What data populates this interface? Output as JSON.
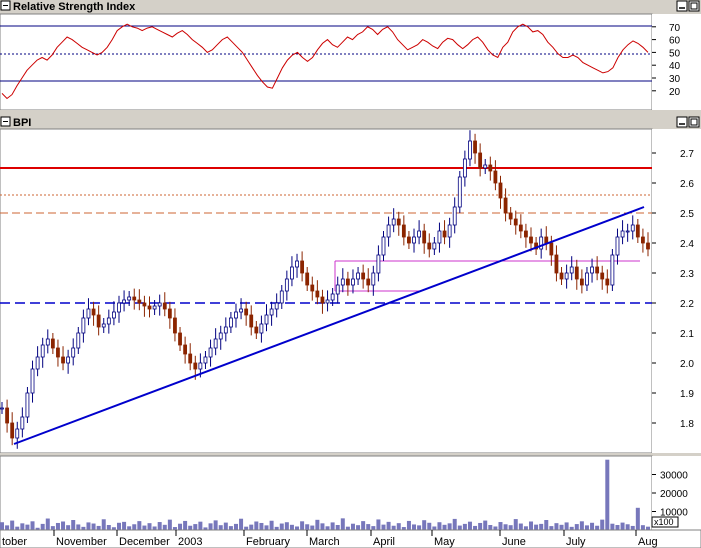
{
  "rsi_panel": {
    "title": "Relative Strength Index",
    "ticks": [
      "70",
      "60",
      "50",
      "40",
      "30",
      "20"
    ]
  },
  "price_panel": {
    "title": "BPI",
    "ticks": [
      "2.7",
      "2.6",
      "2.5",
      "2.4",
      "2.3",
      "2.2",
      "2.1",
      "2.0",
      "1.9",
      "1.8"
    ]
  },
  "volume_panel": {
    "ticks": [
      "30000",
      "20000",
      "10000"
    ],
    "multiplier": "x100"
  },
  "x_axis": {
    "labels": [
      "tober",
      "November",
      "December",
      "2003",
      "February",
      "March",
      "April",
      "May",
      "June",
      "July",
      "Aug"
    ]
  },
  "colors": {
    "rsi_line": "#cc0000",
    "price_up": "#000080",
    "price_down": "#8b2500",
    "trendline": "#0000cc",
    "resistance_solid": "#dd0000",
    "dashed_orange": "#cc6633",
    "dashed_blue": "#0000cc",
    "volume": "#7777bb",
    "magenta": "#cc33cc"
  },
  "chart_data": [
    {
      "type": "line",
      "title": "Relative Strength Index",
      "ylim": [
        10,
        80
      ],
      "reference_lines": [
        70,
        50,
        30
      ],
      "series": [
        {
          "values": [
            18,
            14,
            17,
            24,
            30,
            36,
            40,
            44,
            46,
            44,
            48,
            54,
            58,
            62,
            60,
            57,
            54,
            52,
            50,
            48,
            50,
            54,
            60,
            67,
            70,
            72,
            70,
            69,
            67,
            69,
            70,
            68,
            66,
            64,
            62,
            65,
            67,
            64,
            60,
            57,
            54,
            50,
            52,
            56,
            60,
            62,
            58,
            54,
            50,
            44,
            38,
            32,
            27,
            23,
            22,
            30,
            38,
            44,
            48,
            50,
            46,
            43,
            46,
            52,
            57,
            60,
            56,
            54,
            58,
            62,
            60,
            64,
            66,
            70,
            68,
            64,
            68,
            70,
            66,
            60,
            56,
            52,
            54,
            56,
            60,
            58,
            55,
            53,
            58,
            61,
            60,
            56,
            53,
            56,
            60,
            62,
            58,
            52,
            48,
            46,
            54,
            58,
            66,
            70,
            72,
            70,
            66,
            67,
            64,
            58,
            54,
            49,
            46,
            46,
            48,
            46,
            42,
            40,
            38,
            36,
            34,
            35,
            38,
            46,
            52,
            56,
            59,
            57,
            54,
            50
          ]
        }
      ]
    },
    {
      "type": "line",
      "title": "BPI",
      "ylim": [
        1.7,
        2.8
      ],
      "series": [
        {
          "values": [
            1.85,
            1.8,
            1.75,
            1.78,
            1.82,
            1.9,
            1.98,
            2.02,
            2.06,
            2.08,
            2.05,
            2.02,
            2.0,
            2.02,
            2.05,
            2.1,
            2.15,
            2.18,
            2.16,
            2.12,
            2.13,
            2.15,
            2.17,
            2.2,
            2.21,
            2.22,
            2.21,
            2.2,
            2.19,
            2.18,
            2.19,
            2.2,
            2.18,
            2.15,
            2.1,
            2.06,
            2.03,
            2.0,
            1.98,
            2.0,
            2.02,
            2.05,
            2.08,
            2.1,
            2.12,
            2.15,
            2.17,
            2.18,
            2.16,
            2.12,
            2.1,
            2.13,
            2.16,
            2.18,
            2.2,
            2.24,
            2.28,
            2.32,
            2.34,
            2.3,
            2.26,
            2.24,
            2.22,
            2.2,
            2.21,
            2.23,
            2.26,
            2.28,
            2.26,
            2.28,
            2.3,
            2.28,
            2.26,
            2.3,
            2.36,
            2.42,
            2.46,
            2.48,
            2.46,
            2.42,
            2.4,
            2.42,
            2.44,
            2.4,
            2.38,
            2.4,
            2.44,
            2.42,
            2.46,
            2.52,
            2.62,
            2.68,
            2.74,
            2.7,
            2.65,
            2.66,
            2.64,
            2.6,
            2.55,
            2.5,
            2.48,
            2.46,
            2.44,
            2.42,
            2.4,
            2.38,
            2.42,
            2.4,
            2.36,
            2.3,
            2.28,
            2.3,
            2.32,
            2.28,
            2.26,
            2.3,
            2.32,
            2.3,
            2.28,
            2.26,
            2.36,
            2.42,
            2.44,
            2.44,
            2.46,
            2.42,
            2.4,
            2.38
          ]
        }
      ],
      "reference_lines": [
        {
          "value": 2.65,
          "style": "solid"
        },
        {
          "value": 2.56,
          "style": "dotted"
        },
        {
          "value": 2.5,
          "style": "dashed"
        },
        {
          "value": 2.2,
          "style": "dashed"
        }
      ],
      "trendline": {
        "from": 1.73,
        "to": 2.52
      }
    },
    {
      "type": "bar",
      "title": "",
      "ylim": [
        0,
        40000
      ],
      "values": [
        4200,
        2500,
        5100,
        1800,
        3600,
        2900,
        4700,
        1200,
        3300,
        6200,
        2100,
        3800,
        4600,
        2600,
        5400,
        3000,
        1700,
        4100,
        3500,
        2200,
        5800,
        2700,
        1500,
        3900,
        4400,
        2000,
        3100,
        4800,
        2400,
        3700,
        1900,
        4300,
        2800,
        5600,
        1600,
        3400,
        4900,
        2300,
        3200,
        4500,
        1400,
        3600,
        5200,
        2600,
        4000,
        2100,
        3300,
        6100,
        1800,
        2900,
        4600,
        3800,
        2500,
        5000,
        1700,
        3500,
        4200,
        2800,
        1900,
        4700,
        3100,
        2400,
        5500,
        3600,
        2000,
        4100,
        2700,
        6300,
        1800,
        3400,
        2600,
        4800,
        3200,
        2100,
        5700,
        2900,
        4400,
        2300,
        3700,
        1600,
        4900,
        3000,
        2500,
        5300,
        3900,
        1900,
        4200,
        2800,
        3600,
        6000,
        2400,
        3300,
        4500,
        2200,
        3800,
        5100,
        2700,
        1900,
        4300,
        3100,
        2600,
        5900,
        3500,
        2000,
        4600,
        2900,
        3300,
        5400,
        2100,
        3700,
        2800,
        4100,
        1700,
        3200,
        4700,
        2500,
        3900,
        2300,
        5600,
        38000,
        3400,
        2700,
        4000,
        3100,
        2200,
        12000,
        2600,
        1800
      ]
    }
  ]
}
